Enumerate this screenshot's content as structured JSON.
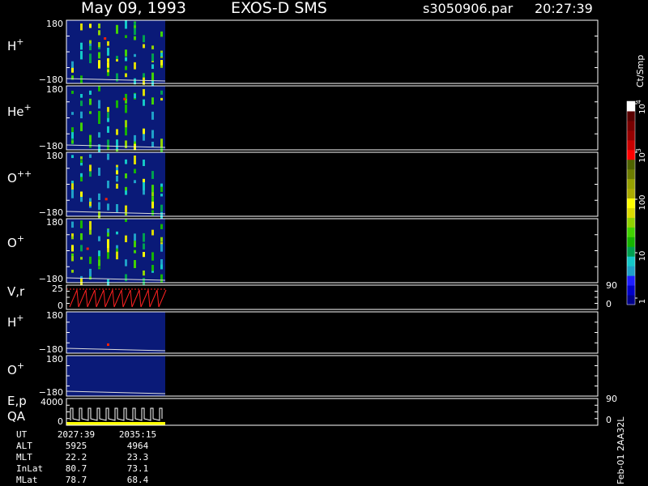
{
  "header": {
    "date": "May 09, 1993",
    "instrument": "EXOS-D SMS",
    "file": "s3050906.par",
    "time": "20:27:39"
  },
  "colorbar": {
    "unit": "Ct/Smp",
    "tick_labels": [
      "1",
      "10",
      "100",
      "10",
      "10"
    ],
    "exponents": [
      "",
      "",
      "",
      "3",
      "4"
    ],
    "colors": [
      "#00008a",
      "#0000c8",
      "#1e1eff",
      "#1fa0c8",
      "#14c8c8",
      "#00a050",
      "#16b400",
      "#41d200",
      "#90d200",
      "#dcdc00",
      "#ffff00",
      "#aaaa00",
      "#96a000",
      "#6e7d00",
      "#506400",
      "#ff0000",
      "#c80000",
      "#960000",
      "#780000",
      "#5a0000",
      "#ffffff"
    ]
  },
  "panels": [
    {
      "name": "H+",
      "base": "H",
      "sup": "+",
      "ytop": "180",
      "ybot": "−180"
    },
    {
      "name": "He+",
      "base": "He",
      "sup": "+",
      "ytop": "180",
      "ybot": "−180"
    },
    {
      "name": "O++",
      "base": "O",
      "sup": "++",
      "ytop": "180",
      "ybot": "−180"
    },
    {
      "name": "O+",
      "base": "O",
      "sup": "+",
      "ytop": "180",
      "ybot": "−180"
    },
    {
      "name": "V,r",
      "base": "V,r",
      "sup": "",
      "ytop": "25",
      "ybot": "0",
      "rtop": "90",
      "rbot": "0"
    },
    {
      "name": "H+",
      "base": "H",
      "sup": "+",
      "ytop": "180",
      "ybot": "−180"
    },
    {
      "name": "O+",
      "base": "O",
      "sup": "+",
      "ytop": "180",
      "ybot": "−180"
    },
    {
      "name": "E,p QA",
      "base": "E,p",
      "base2": "QA",
      "sup": "",
      "ytop": "4000",
      "ybot": "0",
      "rtop": "90",
      "rbot": "0"
    }
  ],
  "footer": {
    "rows": [
      {
        "key": "UT",
        "v1": "2027:39",
        "v2": "2035:15"
      },
      {
        "key": "ALT",
        "v1": "5925",
        "v2": "4964"
      },
      {
        "key": "MLT",
        "v1": "22.2",
        "v2": "23.3"
      },
      {
        "key": "InLat",
        "v1": "80.7",
        "v2": "73.1"
      },
      {
        "key": "MLat",
        "v1": "78.7",
        "v2": "68.4"
      }
    ],
    "side_note": "Feb-01 2AA32L"
  },
  "chart_data": {
    "type": "heatmap",
    "title": "May 09, 1993   EXOS-D SMS",
    "x": [
      "2027:39",
      "2035:15"
    ],
    "panels_y_ranges": {
      "H+": [
        -180,
        180
      ],
      "He+": [
        -180,
        180
      ],
      "O++": [
        -180,
        180
      ],
      "O+": [
        -180,
        180
      ],
      "V,r": [
        0,
        25
      ],
      "H+ (2)": [
        -180,
        180
      ],
      "O+ (2)": [
        -180,
        180
      ],
      "E,p": [
        0,
        4000
      ]
    },
    "right_axis_ranges": {
      "V,r": [
        0,
        90
      ],
      "E,p": [
        0,
        90
      ]
    },
    "colorbar_scale": "log",
    "colorbar_range": [
      1,
      10000
    ]
  }
}
